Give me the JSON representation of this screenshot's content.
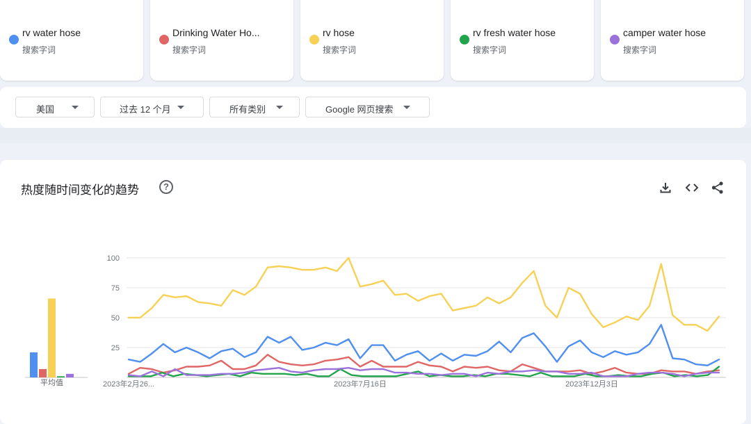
{
  "terms": [
    {
      "name": "rv water hose",
      "sub": "搜索字词",
      "color": "#4285f4"
    },
    {
      "name": "Drinking Water Ho...",
      "sub": "搜索字词",
      "color": "#db4437"
    },
    {
      "name": "rv hose",
      "sub": "搜索字词",
      "color": "#f4b400"
    },
    {
      "name": "rv fresh water hose",
      "sub": "搜索字词",
      "color": "#0f9d58"
    },
    {
      "name": "camper water hose",
      "sub": "搜索字词",
      "color": "#7e57c2"
    }
  ],
  "filters": [
    {
      "label": "美国"
    },
    {
      "label": "过去 12 个月"
    },
    {
      "label": "所有类别"
    },
    {
      "label": "Google 网页搜索"
    }
  ],
  "main": {
    "title": "热度随时间变化的趋势",
    "help_icon": "help-icon",
    "tools": [
      "download-icon",
      "embed-code-icon",
      "share-icon"
    ],
    "avg_label": "平均值"
  },
  "chart_data": {
    "type": "line",
    "x_tick_labels": [
      "2023年2月26...",
      "2023年7月16日",
      "2023年12月3日"
    ],
    "ylim": [
      0,
      100
    ],
    "yticks": [
      25,
      50,
      75,
      100
    ],
    "grid": true,
    "averages": [
      21,
      7,
      66,
      1,
      3
    ],
    "series": [
      {
        "name": "rv water hose",
        "color": "#4f8ff0",
        "values": [
          15,
          13,
          20,
          28,
          21,
          25,
          21,
          16,
          22,
          24,
          17,
          21,
          34,
          29,
          34,
          23,
          25,
          29,
          27,
          32,
          16,
          27,
          27,
          14,
          19,
          22,
          14,
          20,
          14,
          19,
          18,
          22,
          30,
          21,
          33,
          37,
          26,
          13,
          26,
          31,
          21,
          17,
          22,
          19,
          21,
          28,
          44,
          16,
          15,
          11,
          10,
          15
        ]
      },
      {
        "name": "Drinking Water Ho...",
        "color": "#e06666",
        "values": [
          3,
          8,
          7,
          4,
          6,
          9,
          9,
          10,
          14,
          7,
          7,
          10,
          19,
          13,
          11,
          10,
          11,
          14,
          15,
          17,
          9,
          14,
          9,
          9,
          9,
          13,
          10,
          9,
          5,
          9,
          8,
          9,
          6,
          5,
          11,
          8,
          5,
          5,
          5,
          6,
          3,
          5,
          8,
          4,
          3,
          3,
          6,
          5,
          5,
          3,
          5,
          6
        ]
      },
      {
        "name": "rv hose",
        "color": "#f7d156",
        "values": [
          50,
          50,
          58,
          69,
          67,
          68,
          63,
          62,
          60,
          73,
          69,
          76,
          92,
          93,
          92,
          90,
          90,
          92,
          89,
          100,
          76,
          78,
          81,
          69,
          70,
          64,
          68,
          70,
          56,
          58,
          60,
          67,
          62,
          67,
          79,
          89,
          60,
          50,
          75,
          70,
          53,
          42,
          46,
          51,
          48,
          60,
          95,
          52,
          44,
          44,
          39,
          51
        ]
      },
      {
        "name": "rv fresh water hose",
        "color": "#22a44c",
        "values": [
          1,
          1,
          1,
          4,
          1,
          3,
          2,
          1,
          2,
          3,
          1,
          4,
          3,
          3,
          3,
          2,
          3,
          1,
          1,
          7,
          2,
          1,
          1,
          1,
          1,
          3,
          5,
          1,
          2,
          1,
          1,
          2,
          1,
          3,
          3,
          2,
          1,
          4,
          1,
          1,
          1,
          3,
          1,
          1,
          2,
          1,
          1,
          3,
          4,
          1,
          2,
          1,
          2,
          9
        ]
      },
      {
        "name": "camper water hose",
        "color": "#9b72db",
        "values": [
          2,
          1,
          5,
          1,
          7,
          2,
          2,
          2,
          3,
          3,
          4,
          6,
          7,
          8,
          5,
          4,
          6,
          7,
          7,
          8,
          6,
          7,
          7,
          4,
          4,
          3,
          3,
          2,
          3,
          3,
          1,
          4,
          3,
          5,
          5,
          6,
          5,
          5,
          3,
          3,
          4,
          1,
          1,
          1,
          3,
          4,
          4,
          3,
          1,
          3,
          4,
          4
        ]
      }
    ]
  }
}
